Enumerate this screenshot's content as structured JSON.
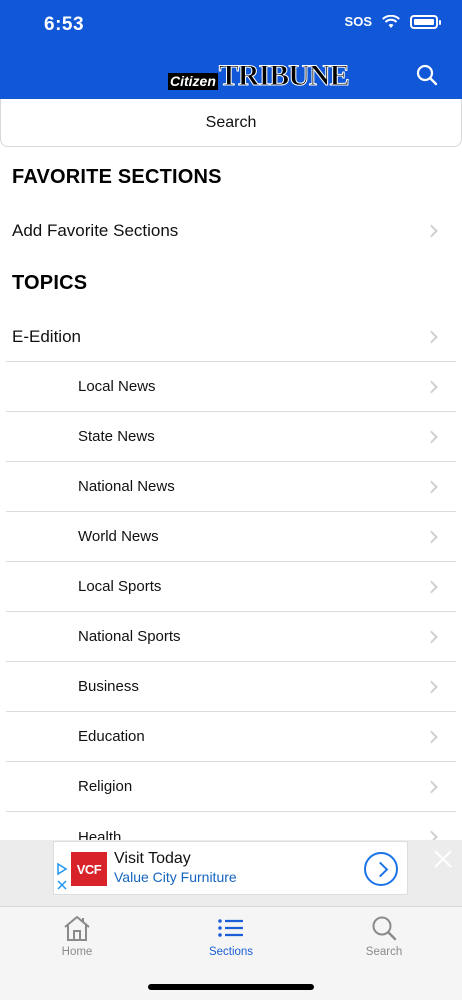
{
  "status_bar": {
    "time": "6:53",
    "sos": "SOS"
  },
  "header": {
    "logo_small": "Citizen",
    "logo_large": "TRIBUNE"
  },
  "search": {
    "label": "Search"
  },
  "favorites": {
    "heading": "FAVORITE SECTIONS",
    "items": [
      {
        "label": "Add Favorite Sections"
      }
    ]
  },
  "topics": {
    "heading": "TOPICS",
    "top_item": {
      "label": "E-Edition"
    },
    "items": [
      {
        "label": "Local News"
      },
      {
        "label": "State News"
      },
      {
        "label": "National News"
      },
      {
        "label": "World News"
      },
      {
        "label": "Local Sports"
      },
      {
        "label": "National Sports"
      },
      {
        "label": "Business"
      },
      {
        "label": "Education"
      },
      {
        "label": "Religion"
      },
      {
        "label": "Health"
      }
    ]
  },
  "ad": {
    "logo_text": "VCF",
    "title": "Visit Today",
    "subtitle": "Value City Furniture"
  },
  "tabbar": {
    "tabs": [
      {
        "label": "Home",
        "icon": "home-icon"
      },
      {
        "label": "Sections",
        "icon": "list-icon",
        "active": true
      },
      {
        "label": "Search",
        "icon": "search-icon"
      }
    ]
  },
  "colors": {
    "header_blue": "#1158d9",
    "active_tab": "#1b5ed8",
    "ad_red": "#d8232a"
  }
}
